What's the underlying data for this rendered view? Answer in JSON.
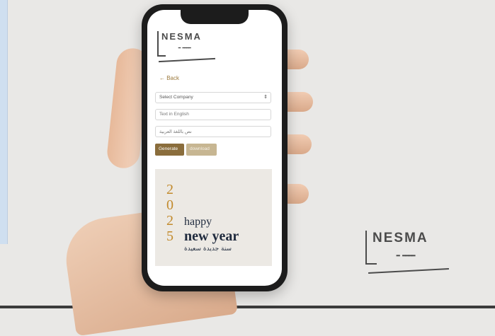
{
  "app": {
    "brand": "NESMA"
  },
  "form": {
    "back_label": "← Back",
    "select_value": "Select Company",
    "text_en_placeholder": "Text in English",
    "text_ar_placeholder": "نص باللغة العربية",
    "generate_label": "Generate",
    "download_label": "download"
  },
  "preview": {
    "year_digits": [
      "2",
      "0",
      "2",
      "5"
    ],
    "happy": "happy",
    "new_year": "new year",
    "arabic_greeting": "سنة جديدة سعيدة"
  },
  "colors": {
    "accent": "#8a6d3c",
    "accent_light": "#c7b692",
    "gold": "#c28a2c",
    "navy": "#1f2a3d"
  },
  "icons": {
    "select_caret": "⌃⌄"
  }
}
